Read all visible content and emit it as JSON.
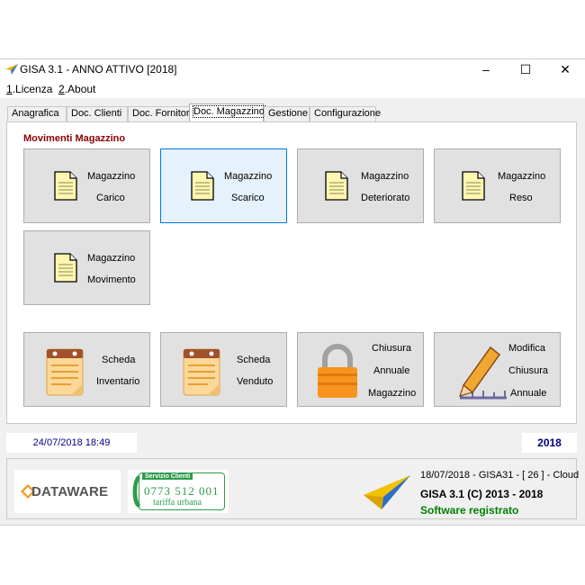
{
  "window": {
    "title": "GISA 3.1 - ANNO ATTIVO  [2018]",
    "controls": {
      "minimize": "–",
      "maximize": "☐",
      "close": "✕"
    }
  },
  "menu": [
    {
      "key": "1",
      "label": ".Licenza"
    },
    {
      "key": "2",
      "label": ".About"
    }
  ],
  "tabs": [
    "Anagrafica",
    "Doc. Clienti",
    "Doc. Fornitori",
    "Doc. Magazzino",
    "Gestione",
    "Configurazione"
  ],
  "active_tab": "Doc. Magazzino",
  "section_title": "Movimenti Magazzino",
  "tiles": {
    "carico": [
      "Magazzino",
      "Carico"
    ],
    "scarico": [
      "Magazzino",
      "Scarico"
    ],
    "deteriorato": [
      "Magazzino",
      "Deteriorato"
    ],
    "reso": [
      "Magazzino",
      "Reso"
    ],
    "movimento": [
      "Magazzino",
      "Movimento"
    ],
    "inventario": [
      "Scheda",
      "Inventario"
    ],
    "venduto": [
      "Scheda",
      "Venduto"
    ],
    "chiusura": [
      "Chiusura",
      "Annuale",
      "Magazzino"
    ],
    "modifica": [
      "Modifica",
      "Chiusura",
      "Annuale"
    ]
  },
  "status": {
    "datetime": "24/07/2018  18:49",
    "year": "2018"
  },
  "footer": {
    "logo_text": "DATAWARE",
    "phone_label": "Servizio Clienti",
    "phone_number": "0773 512 001",
    "phone_note": "tariffa urbana",
    "build_info": "18/07/2018 - GISA31 - [ 26 ] - Cloud",
    "copyright": "GISA 3.1 (C) 2013 - 2018",
    "registration": "Software registrato"
  },
  "colors": {
    "section_title": "#8b0000",
    "status_text": "#000080",
    "registered": "#008000",
    "logo_orange": "#f7941d",
    "phone_green": "#2e9c4a"
  }
}
